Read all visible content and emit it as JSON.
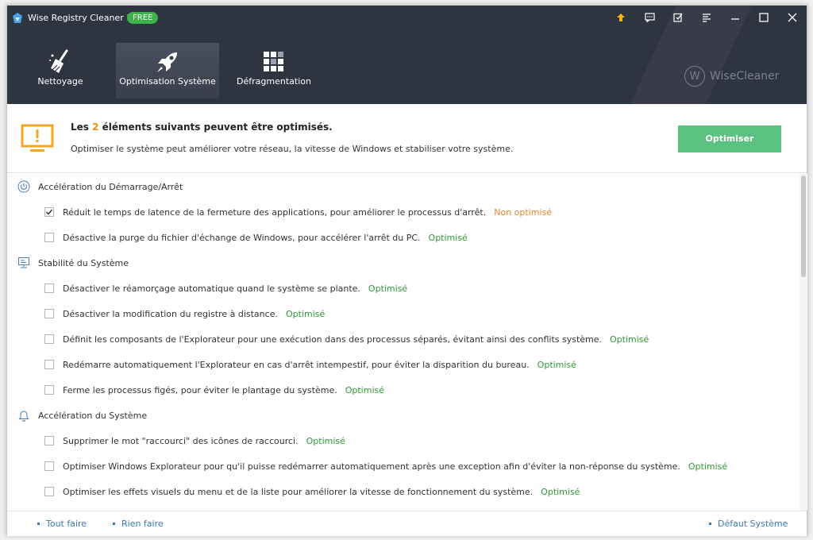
{
  "app": {
    "title": "Wise Registry Cleaner 11",
    "badge": "FREE"
  },
  "nav": {
    "tabs": [
      {
        "label": "Nettoyage",
        "icon": "broom-icon",
        "active": false
      },
      {
        "label": "Optimisation Système",
        "icon": "rocket-icon",
        "active": true
      },
      {
        "label": "Défragmentation",
        "icon": "grid-icon",
        "active": false
      }
    ]
  },
  "brand": {
    "text": "WiseCleaner",
    "mark": "W"
  },
  "summary": {
    "title_prefix": "Les ",
    "count": "2",
    "title_suffix": " éléments suivants peuvent être optimisés.",
    "description": "Optimiser le système peut améliorer votre réseau, la vitesse de Windows et stabiliser votre système.",
    "button": "Optimiser"
  },
  "categories": [
    {
      "label": "Accélération du Démarrage/Arrêt",
      "icon": "power-icon",
      "items": [
        {
          "text": "Réduit le temps de latence de la fermeture des applications, pour améliorer le processus d'arrêt.",
          "status": "Non optimisé",
          "checked": true
        },
        {
          "text": "Désactive la purge du fichier d'échange de Windows, pour accélérer l'arrêt du PC.",
          "status": "Optimisé",
          "checked": false
        }
      ]
    },
    {
      "label": "Stabilité du Système",
      "icon": "system-icon",
      "items": [
        {
          "text": "Désactiver le réamorçage automatique quand le système se plante.",
          "status": "Optimisé",
          "checked": false
        },
        {
          "text": "Désactiver la modification du registre à distance.",
          "status": "Optimisé",
          "checked": false
        },
        {
          "text": "Définit les composants de l'Explorateur pour une exécution dans des processus séparés, évitant ainsi des conflits système.",
          "status": "Optimisé",
          "checked": false
        },
        {
          "text": "Redémarre automatiquement l'Explorateur en cas d'arrêt intempestif, pour éviter la disparition du bureau.",
          "status": "Optimisé",
          "checked": false
        },
        {
          "text": "Ferme les processus figés, pour éviter le plantage du système.",
          "status": "Optimisé",
          "checked": false
        }
      ]
    },
    {
      "label": "Accélération du Système",
      "icon": "bell-icon",
      "items": [
        {
          "text": "Supprimer le mot \"raccourci\" des icônes de raccourci.",
          "status": "Optimisé",
          "checked": false
        },
        {
          "text": "Optimiser Windows Explorateur pour qu'il puisse redémarrer automatiquement après une exception afin d'éviter la non-réponse du système.",
          "status": "Optimisé",
          "checked": false
        },
        {
          "text": "Optimiser les effets visuels du menu et de la liste pour améliorer la vitesse de fonctionnement du système.",
          "status": "Optimisé",
          "checked": false
        }
      ]
    }
  ],
  "footer": {
    "select_all": "Tout faire",
    "select_none": "Rien faire",
    "system_default": "Défaut Système"
  },
  "colors": {
    "header": "#2f3441",
    "accent_green": "#5cc281",
    "status_ok": "#2e9a35",
    "status_warn": "#e6862c",
    "link": "#3a78b5",
    "highlight": "#f08c1a"
  }
}
